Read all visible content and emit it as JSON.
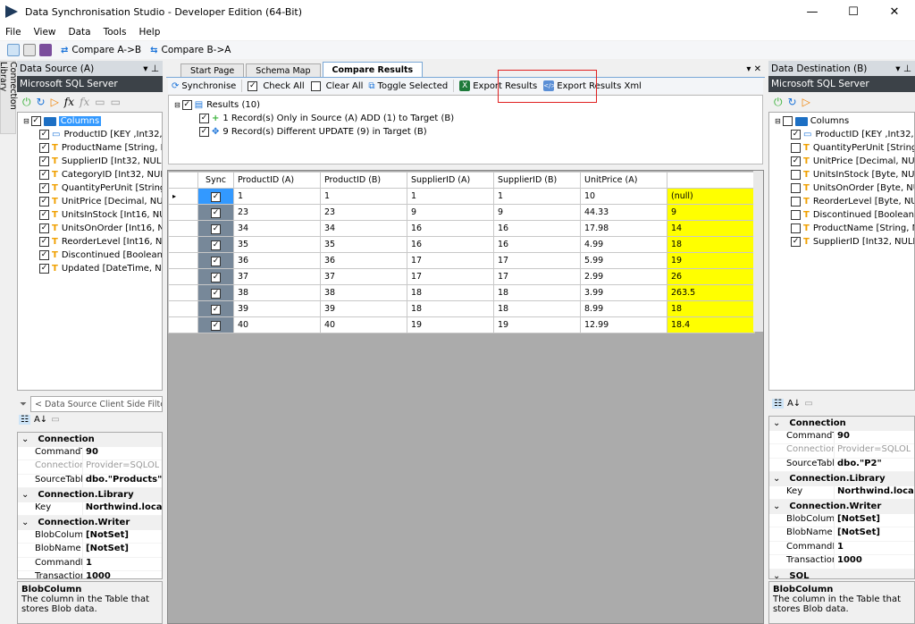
{
  "window": {
    "title": "Data Synchronisation Studio - Developer Edition (64-Bit)",
    "controls": [
      "—",
      "☐",
      "✕"
    ]
  },
  "menu": [
    "File",
    "View",
    "Data",
    "Tools",
    "Help"
  ],
  "toolbar": {
    "compare_ab": "Compare A->B",
    "compare_ba": "Compare B->A"
  },
  "side_tab": "Connection Library",
  "source": {
    "title": "Data Source (A)",
    "provider": "Microsoft SQL Server",
    "root": "Columns",
    "columns": [
      "ProductID [KEY ,Int32, N",
      "ProductName [String, N",
      "SupplierID [Int32, NULL",
      "CategoryID [Int32, NUL",
      "QuantityPerUnit [String",
      "UnitPrice [Decimal, NU",
      "UnitsInStock [Int16, NU",
      "UnitsOnOrder [Int16, N",
      "ReorderLevel [Int16, NU",
      "Discontinued [Boolean,",
      "Updated [DateTime, NU"
    ],
    "filter_placeholder": "< Data Source Client Side Filter E",
    "props": [
      {
        "cat": "Connection"
      },
      {
        "k": "CommandT",
        "v": "90"
      },
      {
        "k": "Connection!",
        "v": "Provider=SQLOL",
        "dim": true
      },
      {
        "k": "SourceTable",
        "v": "dbo.\"Products\""
      },
      {
        "cat": "Connection.Library"
      },
      {
        "k": "Key",
        "v": "Northwind.loca"
      },
      {
        "cat": "Connection.Writer"
      },
      {
        "k": "BlobColumr",
        "v": "[NotSet]"
      },
      {
        "k": "BlobName",
        "v": "[NotSet]"
      },
      {
        "k": "CommandB",
        "v": "1"
      },
      {
        "k": "Transaction",
        "v": "1000"
      }
    ],
    "desc_title": "BlobColumn",
    "desc_text": "The column in the Table that stores Blob data."
  },
  "dest": {
    "title": "Data Destination (B)",
    "provider": "Microsoft SQL Server",
    "root": "Columns",
    "columns": [
      {
        "t": "ProductID [KEY ,Int32, N",
        "c": true
      },
      {
        "t": "QuantityPerUnit [String",
        "c": false
      },
      {
        "t": "UnitPrice [Decimal, NU",
        "c": true
      },
      {
        "t": "UnitsInStock [Byte, NUI",
        "c": false
      },
      {
        "t": "UnitsOnOrder [Byte, NU",
        "c": false
      },
      {
        "t": "ReorderLevel [Byte, NU",
        "c": false
      },
      {
        "t": "Discontinued [Boolean,",
        "c": false
      },
      {
        "t": "ProductName [String, N",
        "c": false
      },
      {
        "t": "SupplierID [Int32, NULL",
        "c": true
      }
    ],
    "props": [
      {
        "cat": "Connection"
      },
      {
        "k": "CommandT",
        "v": "90"
      },
      {
        "k": "Connection!",
        "v": "Provider=SQLOL",
        "dim": true
      },
      {
        "k": "SourceTable",
        "v": "dbo.\"P2\""
      },
      {
        "cat": "Connection.Library"
      },
      {
        "k": "Key",
        "v": "Northwind.loca"
      },
      {
        "cat": "Connection.Writer"
      },
      {
        "k": "BlobColumr",
        "v": "[NotSet]"
      },
      {
        "k": "BlobName",
        "v": "[NotSet]"
      },
      {
        "k": "CommandB",
        "v": "1"
      },
      {
        "k": "Transaction",
        "v": "1000"
      },
      {
        "cat": "SQL"
      }
    ],
    "desc_title": "BlobColumn",
    "desc_text": "The column in the Table that stores Blob data."
  },
  "tabs": [
    "Start Page",
    "Schema Map",
    "Compare Results"
  ],
  "compare_toolbar": {
    "sync": "Synchronise",
    "check_all": "Check All",
    "clear_all": "Clear All",
    "toggle": "Toggle Selected",
    "export": "Export Results",
    "export_xml": "Export Results Xml"
  },
  "results": {
    "root": "Results (10)",
    "items": [
      "1 Record(s) Only in Source (A) ADD (1) to Target (B)",
      "9 Record(s) Different UPDATE (9) in Target (B)"
    ]
  },
  "grid": {
    "headers": [
      "Sync",
      "ProductID (A)",
      "ProductID (B)",
      "SupplierID (A)",
      "SupplierID (B)",
      "UnitPrice (A)",
      ""
    ],
    "rows": [
      [
        "1",
        "1",
        "1",
        "1",
        "10",
        "(null)"
      ],
      [
        "23",
        "23",
        "9",
        "9",
        "44.33",
        "9"
      ],
      [
        "34",
        "34",
        "16",
        "16",
        "17.98",
        "14"
      ],
      [
        "35",
        "35",
        "16",
        "16",
        "4.99",
        "18"
      ],
      [
        "36",
        "36",
        "17",
        "17",
        "5.99",
        "19"
      ],
      [
        "37",
        "37",
        "17",
        "17",
        "2.99",
        "26"
      ],
      [
        "38",
        "38",
        "18",
        "18",
        "3.99",
        "263.5"
      ],
      [
        "39",
        "39",
        "18",
        "18",
        "8.99",
        "18"
      ],
      [
        "40",
        "40",
        "19",
        "19",
        "12.99",
        "18.4"
      ]
    ],
    "highlight_color": "#ffff00"
  }
}
